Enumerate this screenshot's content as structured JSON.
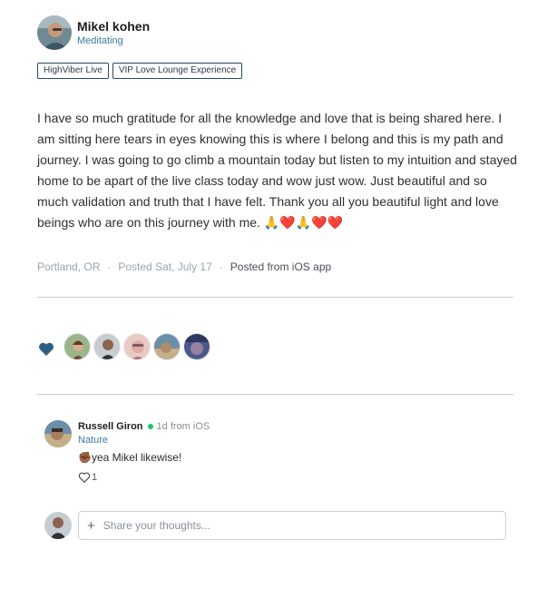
{
  "post": {
    "author_name": "Mikel kohen",
    "author_status": "Meditating",
    "tags": [
      "HighViber Live",
      "VIP Love Lounge Experience"
    ],
    "body": "I have so much gratitude for all the knowledge and love that is being shared here. I am sitting here tears in eyes knowing this is where I belong and this is my path and journey. I was going to go climb a mountain today but listen to my intuition and stayed home to be apart of the live class today and wow just wow. Just beautiful and so much validation and truth that I have felt. Thank you all you beautiful light and love beings who are on this journey with me. 🙏❤️🙏❤️❤️",
    "location": "Portland, OR",
    "posted_date": "Posted Sat, July 17",
    "posted_from": "Posted from iOS app"
  },
  "reactions": {
    "icon": "heart-icon",
    "color": "#2e5f82",
    "reactor_count": 5
  },
  "comment": {
    "name": "Russell Giron",
    "time": "1d from iOS",
    "status": "Nature",
    "emoji": "✊🏾",
    "text": "yea Mikel likewise!",
    "likes": "1"
  },
  "composer": {
    "placeholder": "Share your thoughts...",
    "icon": "plus-icon"
  },
  "colors": {
    "accent": "#3a7aa0",
    "online": "#22c36c",
    "tag_border": "#274a63"
  }
}
